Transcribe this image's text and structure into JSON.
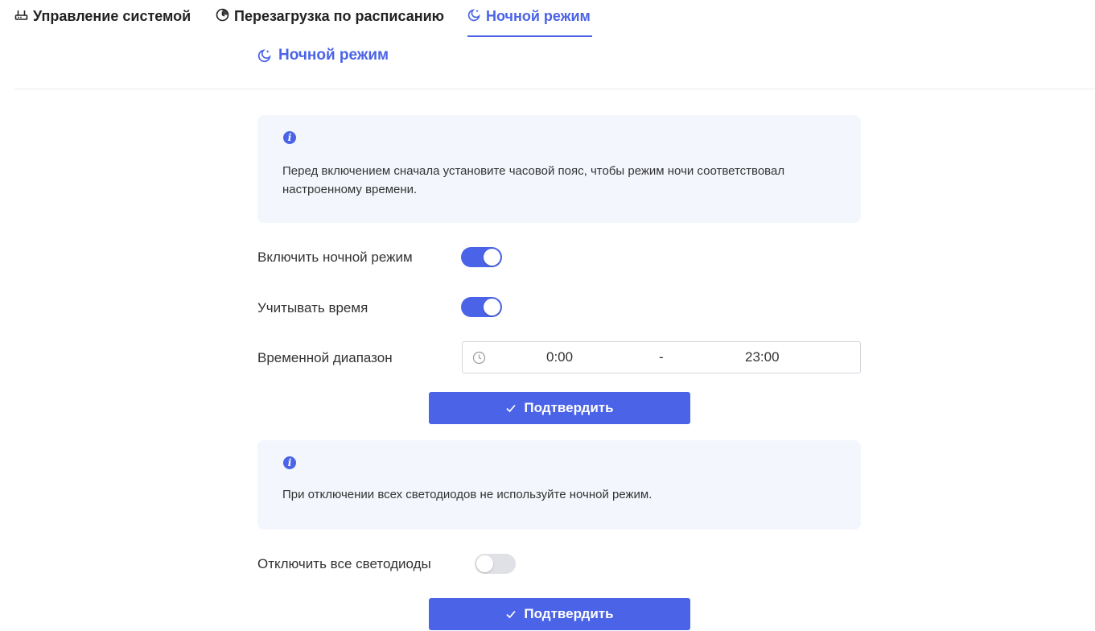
{
  "tabs": [
    {
      "label": "Управление системой",
      "icon": "router-icon",
      "active": false
    },
    {
      "label": "Перезагрузка по расписанию",
      "icon": "clock-icon",
      "active": false
    },
    {
      "label": "Ночной режим",
      "icon": "moon-icon",
      "active": true
    }
  ],
  "section": {
    "title": "Ночной режим",
    "icon": "moon-icon"
  },
  "info1": {
    "text": "Перед включением сначала установите часовой пояс, чтобы режим ночи соответствовал настроенному времени."
  },
  "night_mode": {
    "label": "Включить ночной режим",
    "enabled": true
  },
  "consider_time": {
    "label": "Учитывать время",
    "enabled": true
  },
  "time_range": {
    "label": "Временной диапазон",
    "start": "0:00",
    "separator": "-",
    "end": "23:00"
  },
  "confirm1": {
    "label": "Подтвердить"
  },
  "info2": {
    "text": "При отключении всех светодиодов не используйте ночной режим."
  },
  "leds_off": {
    "label": "Отключить все светодиоды",
    "enabled": false
  },
  "confirm2": {
    "label": "Подтвердить"
  },
  "colors": {
    "accent": "#4a63e7",
    "info_bg": "#f3f7fd",
    "toggle_off": "#e0e1e6"
  }
}
